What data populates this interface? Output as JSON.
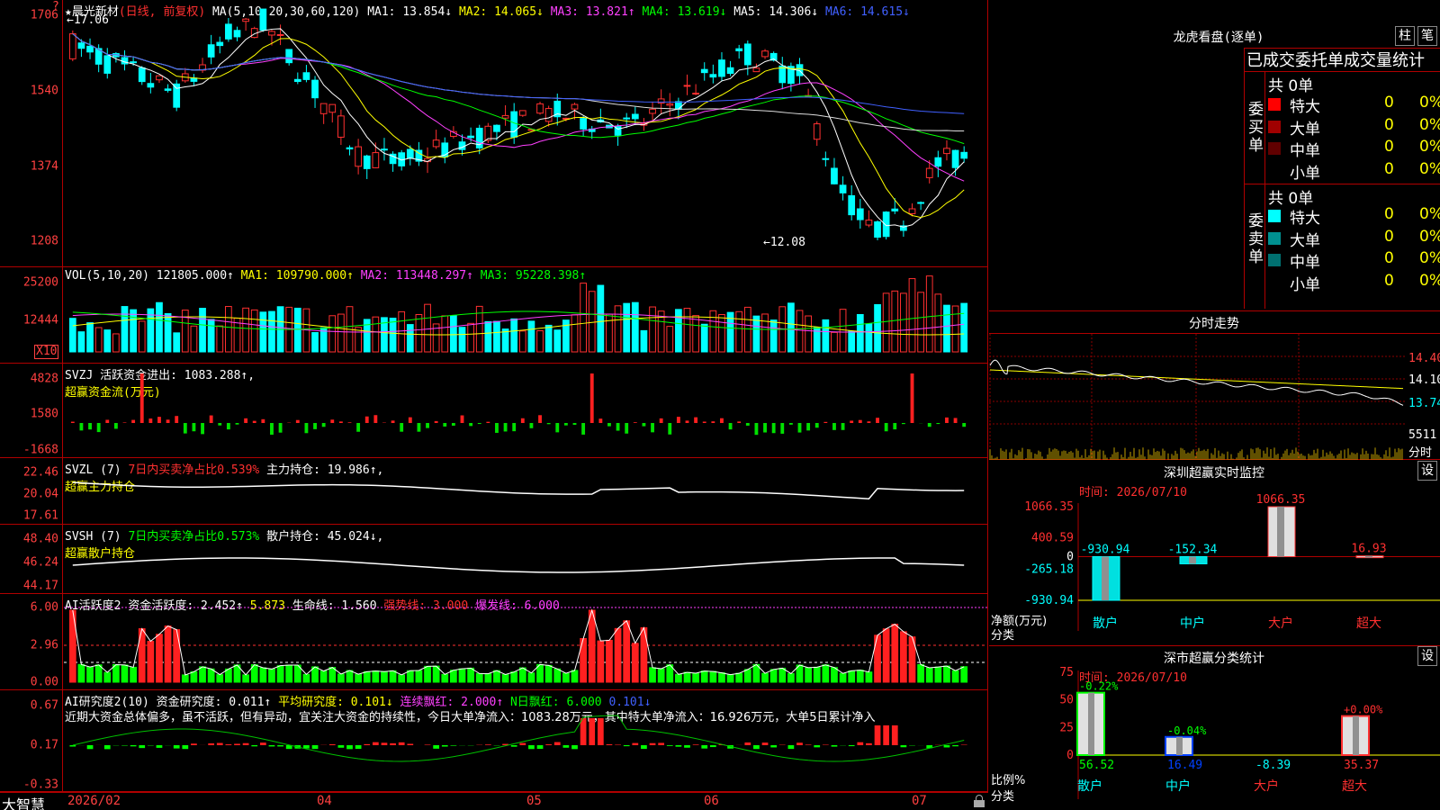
{
  "main": {
    "title_star": "★",
    "stock_name": "晨光新材",
    "mode": "(日线, 前复权)",
    "ma_label": "MA(5,10,20,30,60,120)",
    "ma1": "MA1: 13.854↓",
    "ma2": "MA2: 14.065↓",
    "ma3": "MA3: 13.821↑",
    "ma4": "MA4: 13.619↓",
    "ma5": "MA5: 14.306↓",
    "ma6": "MA6: 14.615↓",
    "high_mark": "←17.06",
    "low_mark": "←12.08",
    "ticks": [
      "1706",
      "1540",
      "1374",
      "1208"
    ],
    "question_mark": "?"
  },
  "vol": {
    "label": "VOL(5,10,20)",
    "value": "121805.000↑",
    "ma1": "MA1: 109790.000↑",
    "ma2": "MA2: 113448.297↑",
    "ma3": "MA3: 95228.398↑",
    "ticks": [
      "25200",
      "12444"
    ],
    "unit": "X10"
  },
  "svzj": {
    "label": "SVZJ",
    "text": "活跃资金进出: 1083.288↑,",
    "sub": "超赢资金流(万元)",
    "ticks": [
      "4828",
      "1580",
      "-1668"
    ]
  },
  "svzl": {
    "label": "SVZL (7)",
    "text1": "7日内买卖净占比0.539%",
    "text2": "主力持仓: 19.986↑,",
    "sub": "超赢主力持仓",
    "ticks": [
      "22.46",
      "20.04",
      "17.61"
    ]
  },
  "svsh": {
    "label": "SVSH (7)",
    "text1": "7日内买卖净占比0.573%",
    "text2": "散户持仓: 45.024↓,",
    "sub": "超赢散户持仓",
    "ticks": [
      "48.40",
      "46.24",
      "44.17"
    ]
  },
  "ai1": {
    "label": "AI活跃度2",
    "t1": "资金活跃度: 2.452↑",
    "t2": "5.873",
    "t3": "生命线: 1.560",
    "t4": "强势线: 3.000",
    "t5": "爆发线: 6.000",
    "ticks": [
      "6.00",
      "2.96",
      "0.00"
    ]
  },
  "ai2": {
    "label": "AI研究度2(10)",
    "t1": "资金研究度: 0.011↑",
    "t2": "平均研究度: 0.101↓",
    "t3": "连续飘红: 2.000↑",
    "t4": "N日飘红: 6.000",
    "t5": "0.101↓",
    "comment": "近期大资金总体偏多，虽不活跃，但有异动，宜关注大资金的持续性，今日大单净流入：1083.28万元，其中特大单净流入：16.926万元，大单5日累计净入",
    "ticks": [
      "0.67",
      "0.17",
      "-0.33"
    ]
  },
  "bottom": {
    "brand": "大智慧",
    "dates": [
      "2026/02",
      "04",
      "05",
      "06",
      "07"
    ]
  },
  "lhb": {
    "title": "龙虎看盘(逐单)",
    "btn1": "柱",
    "btn2": "笔",
    "stats_title": "已成交委托单成交量统计",
    "buy_side": "委买单",
    "sell_side": "委卖单",
    "buy_total": "共 0单",
    "sell_total": "共 0单",
    "buy_rows": [
      {
        "name": "特大",
        "count": "0",
        "pct": "0%",
        "color": "#ff0000"
      },
      {
        "name": "大单",
        "count": "0",
        "pct": "0%",
        "color": "#a00000"
      },
      {
        "name": "中单",
        "count": "0",
        "pct": "0%",
        "color": "#600000"
      },
      {
        "name": "小单",
        "count": "0",
        "pct": "0%",
        "color": ""
      }
    ],
    "sell_rows": [
      {
        "name": "特大",
        "count": "0",
        "pct": "0%",
        "color": "#00ffff"
      },
      {
        "name": "大单",
        "count": "0",
        "pct": "0%",
        "color": "#009090"
      },
      {
        "name": "中单",
        "count": "0",
        "pct": "0%",
        "color": "#007070"
      },
      {
        "name": "小单",
        "count": "0",
        "pct": "0%",
        "color": ""
      }
    ]
  },
  "intraday": {
    "title": "分时走势",
    "ticks": [
      "14.40",
      "14.10",
      "13.74"
    ],
    "vol_tick": "5511",
    "vol_unit": "分时"
  },
  "sz_monitor": {
    "title": "深圳超赢实时监控",
    "btn": "设",
    "date": "时间: 2026/07/10",
    "ticks": [
      "1066.35",
      "400.59",
      "0",
      "-265.18",
      "-930.94"
    ],
    "ylabel": "净额(万元)",
    "xlabel": "分类",
    "values": [
      "-930.94",
      "-152.34",
      "1066.35",
      "16.93"
    ],
    "cats": [
      "散户",
      "中户",
      "大户",
      "超大"
    ]
  },
  "sz_stats": {
    "title": "深市超赢分类统计",
    "btn": "设",
    "date": "时间: 2026/07/10",
    "ticks": [
      "75",
      "50",
      "25",
      "0"
    ],
    "ylabel": "比例%",
    "xlabel": "分类",
    "top_labels": [
      "-0.22%",
      "-0.04%",
      "",
      "+0.00%"
    ],
    "bottom_labels": [
      "56.52",
      "16.49",
      "-8.39",
      "35.37"
    ],
    "cats": [
      "散户",
      "中户",
      "大户",
      "超大"
    ]
  },
  "chart_data": [
    {
      "type": "candlestick",
      "title": "晨光新材 (日线, 前复权)",
      "ylim": [
        12.08,
        17.06
      ],
      "y_ticks": [
        17.06,
        15.4,
        13.74,
        12.08
      ],
      "high": 17.06,
      "low": 12.08
    },
    {
      "type": "bar",
      "title": "深圳超赢实时监控",
      "categories": [
        "散户",
        "中户",
        "大户",
        "超大"
      ],
      "values": [
        -930.94,
        -152.34,
        1066.35,
        16.93
      ],
      "ylabel": "净额(万元)",
      "xlabel": "分类",
      "ylim": [
        -930.94,
        1066.35
      ]
    },
    {
      "type": "bar",
      "title": "深市超赢分类统计",
      "categories": [
        "散户",
        "中户",
        "大户",
        "超大"
      ],
      "values": [
        56.52,
        16.49,
        -8.39,
        35.37
      ],
      "changes": [
        "-0.22%",
        "-0.04%",
        "",
        "+0.00%"
      ],
      "ylabel": "比例%",
      "xlabel": "分类",
      "ylim": [
        0,
        75
      ]
    }
  ]
}
